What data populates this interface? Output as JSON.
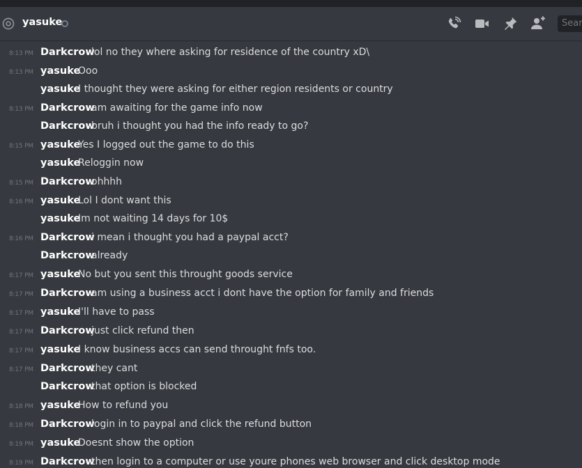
{
  "header": {
    "channel_name": "yasuke",
    "search_placeholder": "Search"
  },
  "messages": [
    {
      "time": "8:13 PM",
      "author": "Darkcrow",
      "text": "lol no they where asking for residence of the country xD\\"
    },
    {
      "time": "8:13 PM",
      "author": "yasuke",
      "text": "Ooo"
    },
    {
      "time": "",
      "author": "yasuke",
      "text": "I thought they were asking for either region residents or country"
    },
    {
      "time": "8:13 PM",
      "author": "Darkcrow",
      "text": "am awaiting for the game info now"
    },
    {
      "time": "",
      "author": "Darkcrow",
      "text": "bruh i thought you had the info ready to go?"
    },
    {
      "time": "8:15 PM",
      "author": "yasuke",
      "text": "Yes I logged out the game to do this"
    },
    {
      "time": "",
      "author": "yasuke",
      "text": "Reloggin now"
    },
    {
      "time": "8:15 PM",
      "author": "Darkcrow",
      "text": "ohhhh"
    },
    {
      "time": "8:16 PM",
      "author": "yasuke",
      "text": "Lol I dont want this"
    },
    {
      "time": "",
      "author": "yasuke",
      "text": "Im not waiting 14 days for 10$"
    },
    {
      "time": "8:16 PM",
      "author": "Darkcrow",
      "text": "i mean i thought you had a paypal acct?"
    },
    {
      "time": "",
      "author": "Darkcrow",
      "text": "already"
    },
    {
      "time": "8:17 PM",
      "author": "yasuke",
      "text": "No but you sent this throught goods service"
    },
    {
      "time": "8:17 PM",
      "author": "Darkcrow",
      "text": "am using a business acct i dont have the option for family and friends"
    },
    {
      "time": "8:17 PM",
      "author": "yasuke",
      "text": "I'll have to pass"
    },
    {
      "time": "8:17 PM",
      "author": "Darkcrow",
      "text": "just click refund then"
    },
    {
      "time": "8:17 PM",
      "author": "yasuke",
      "text": "I know business accs can send throught fnfs too."
    },
    {
      "time": "8:17 PM",
      "author": "Darkcrow",
      "text": "they cant"
    },
    {
      "time": "",
      "author": "Darkcrow",
      "text": "that option is blocked"
    },
    {
      "time": "8:18 PM",
      "author": "yasuke",
      "text": "How to refund you"
    },
    {
      "time": "8:18 PM",
      "author": "Darkcrow",
      "text": "login in to paypal and click the refund button"
    },
    {
      "time": "8:19 PM",
      "author": "yasuke",
      "text": "Doesnt show the option"
    },
    {
      "time": "8:19 PM",
      "author": "Darkcrow",
      "text": "then login to a computer or use youre phones web browser and click desktop mode"
    }
  ],
  "colors": {
    "background": "#36393f",
    "author": "#ffffff",
    "text": "#dcddde",
    "timestamp": "#72767d",
    "icon": "#b9bbbe"
  }
}
